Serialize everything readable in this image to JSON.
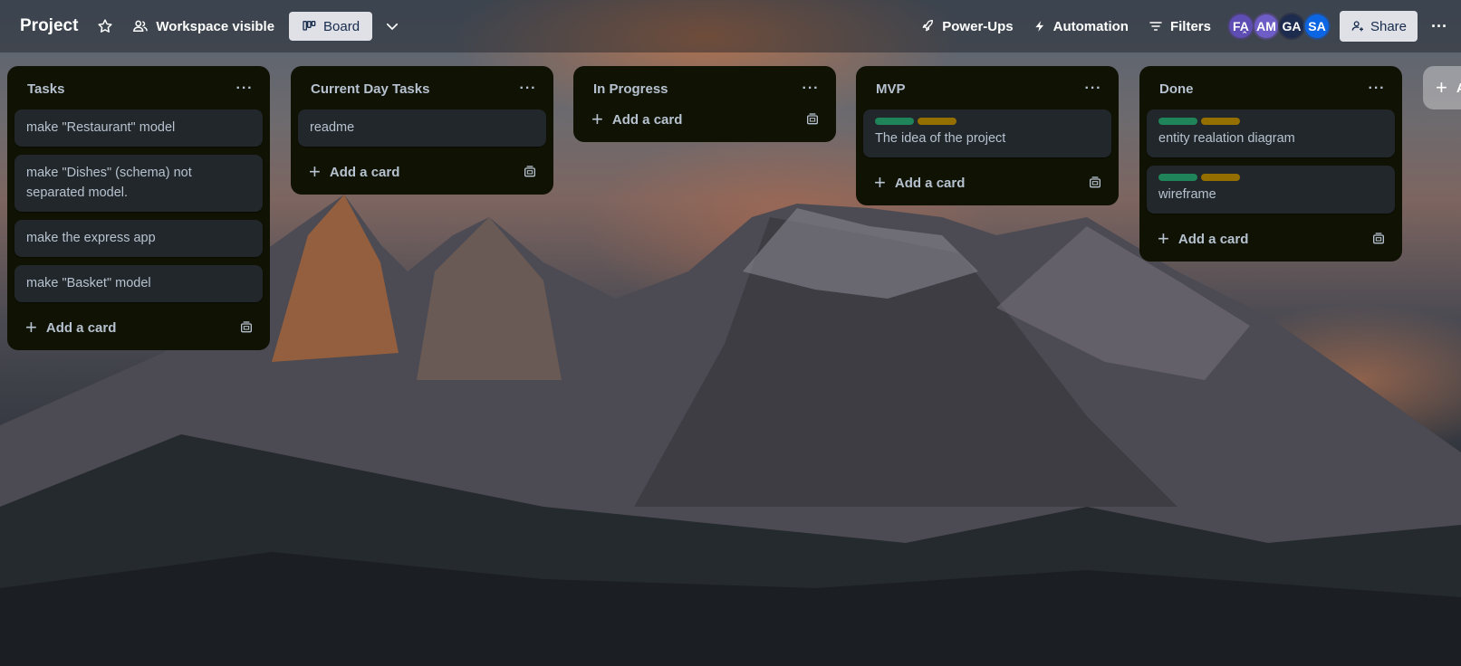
{
  "board": {
    "title": "Project",
    "visibility": "Workspace visible",
    "view": "Board"
  },
  "header_right": {
    "power_ups": "Power-Ups",
    "automation": "Automation",
    "filters": "Filters",
    "share": "Share",
    "more": "···"
  },
  "members": [
    {
      "initials": "FA",
      "color": "#5e4db2"
    },
    {
      "initials": "AM",
      "color": "#6e5dc6"
    },
    {
      "initials": "GA",
      "color": "#1d2b4f"
    },
    {
      "initials": "SA",
      "color": "#0c66e4"
    }
  ],
  "label_colors": {
    "green": "#1f845a",
    "yellow": "#946f00"
  },
  "lists": [
    {
      "title": "Tasks",
      "cards": [
        {
          "text": "make \"Restaurant\" model"
        },
        {
          "text": "make \"Dishes\" (schema) not separated model."
        },
        {
          "text": "make the express app"
        },
        {
          "text": "make \"Basket\" model"
        }
      ],
      "add_label": "Add a card"
    },
    {
      "title": "Current Day Tasks",
      "cards": [
        {
          "text": "readme"
        }
      ],
      "add_label": "Add a card"
    },
    {
      "title": "In Progress",
      "cards": [],
      "add_label": "Add a card"
    },
    {
      "title": "MVP",
      "cards": [
        {
          "text": "The idea of the project",
          "labels": [
            "green",
            "yellow"
          ]
        }
      ],
      "add_label": "Add a card"
    },
    {
      "title": "Done",
      "cards": [
        {
          "text": "entity realation diagram",
          "labels": [
            "green",
            "yellow"
          ]
        },
        {
          "text": "wireframe",
          "labels": [
            "green",
            "yellow"
          ]
        }
      ],
      "add_label": "Add a card"
    }
  ],
  "list_menu": "···",
  "add_list_label": "A"
}
